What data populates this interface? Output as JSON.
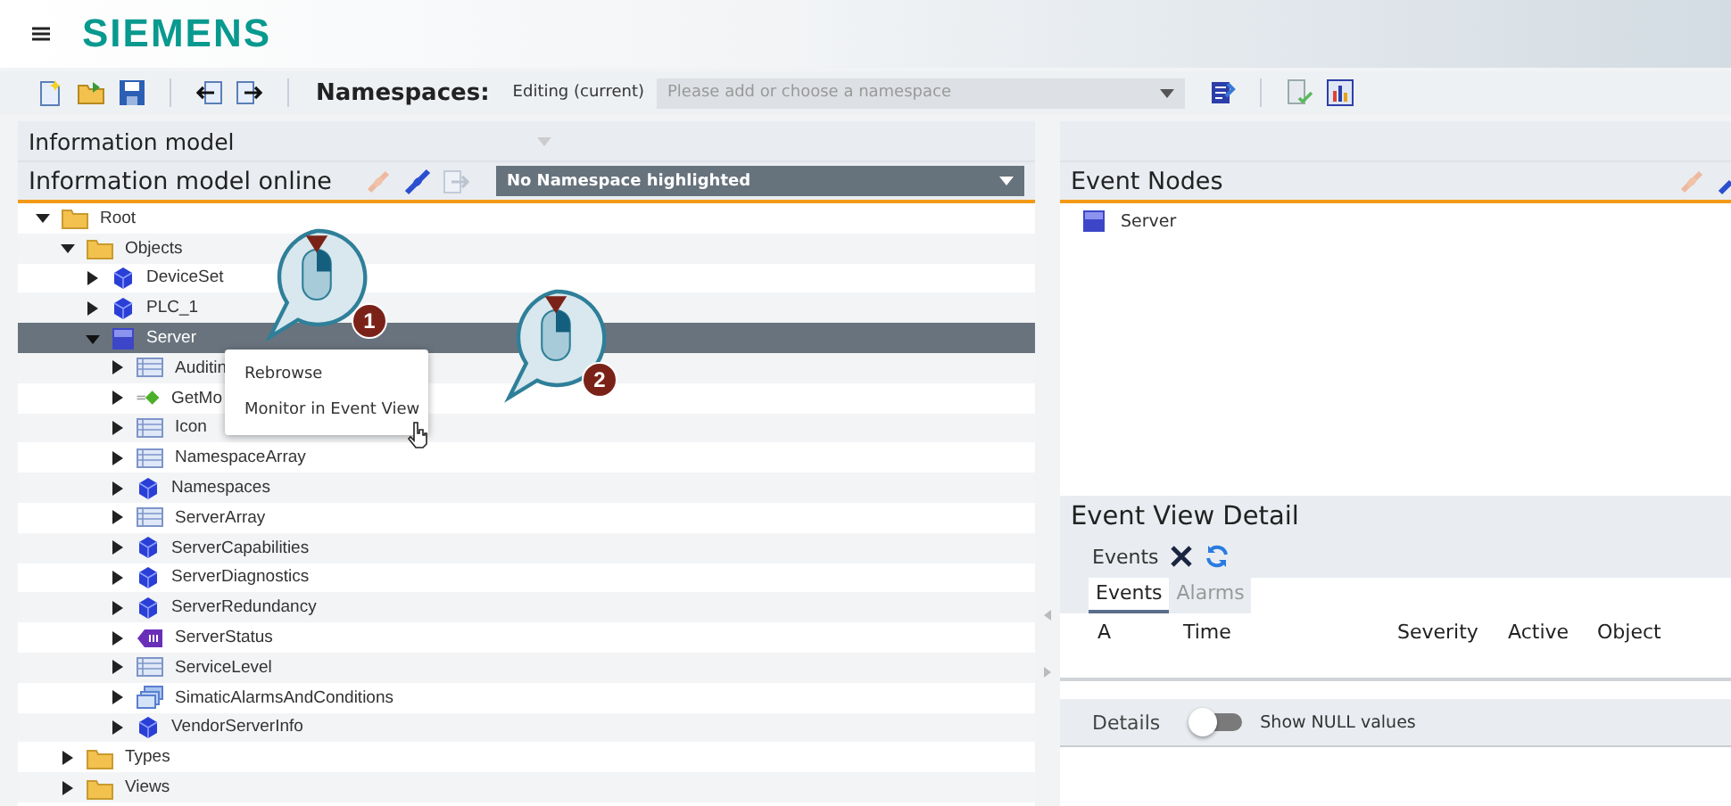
{
  "header": {
    "logo": "SIEMENS"
  },
  "toolbar": {
    "namespaces_label": "Namespaces:",
    "mode": "Editing (current)",
    "namespace_select": {
      "placeholder": "Please add or choose a namespace"
    }
  },
  "left_panel": {
    "title": "Information model",
    "subtitle": "Information model online",
    "highlight_select": {
      "value": "No Namespace highlighted"
    },
    "tree": [
      {
        "label": "Root",
        "kind": "folder",
        "expanded": true,
        "selected": false,
        "children": [
          {
            "label": "Objects",
            "kind": "folder",
            "expanded": true,
            "selected": false,
            "children": [
              {
                "label": "DeviceSet",
                "kind": "cube",
                "expanded": false,
                "selected": false
              },
              {
                "label": "PLC_1",
                "kind": "cube",
                "expanded": false,
                "selected": false
              },
              {
                "label": "Server",
                "kind": "opc",
                "expanded": true,
                "selected": true,
                "children": [
                  {
                    "label": "Auditin",
                    "kind": "table",
                    "expanded": false,
                    "selected": false
                  },
                  {
                    "label": "GetMo",
                    "kind": "method",
                    "expanded": false,
                    "selected": false
                  },
                  {
                    "label": "Icon",
                    "kind": "table",
                    "expanded": false,
                    "selected": false
                  },
                  {
                    "label": "NamespaceArray",
                    "kind": "table",
                    "expanded": false,
                    "selected": false
                  },
                  {
                    "label": "Namespaces",
                    "kind": "cube",
                    "expanded": false,
                    "selected": false
                  },
                  {
                    "label": "ServerArray",
                    "kind": "table",
                    "expanded": false,
                    "selected": false
                  },
                  {
                    "label": "ServerCapabilities",
                    "kind": "cube",
                    "expanded": false,
                    "selected": false
                  },
                  {
                    "label": "ServerDiagnostics",
                    "kind": "cube",
                    "expanded": false,
                    "selected": false
                  },
                  {
                    "label": "ServerRedundancy",
                    "kind": "cube",
                    "expanded": false,
                    "selected": false
                  },
                  {
                    "label": "ServerStatus",
                    "kind": "tag",
                    "expanded": false,
                    "selected": false
                  },
                  {
                    "label": "ServiceLevel",
                    "kind": "table",
                    "expanded": false,
                    "selected": false
                  },
                  {
                    "label": "SimaticAlarmsAndConditions",
                    "kind": "alarms",
                    "expanded": false,
                    "selected": false
                  },
                  {
                    "label": "VendorServerInfo",
                    "kind": "cube",
                    "expanded": false,
                    "selected": false
                  }
                ]
              }
            ]
          },
          {
            "label": "Types",
            "kind": "folder",
            "expanded": false,
            "selected": false
          },
          {
            "label": "Views",
            "kind": "folder",
            "expanded": false,
            "selected": false
          }
        ]
      }
    ]
  },
  "context_menu": {
    "items": [
      {
        "label": "Rebrowse"
      },
      {
        "label": "Monitor in Event View"
      }
    ]
  },
  "callouts": [
    {
      "number": "1"
    },
    {
      "number": "2"
    }
  ],
  "event_nodes": {
    "title": "Event Nodes",
    "items": [
      {
        "label": "Server"
      }
    ]
  },
  "event_view_detail": {
    "title": "Event View Detail",
    "toolbar_label": "Events",
    "tabs": [
      {
        "label": "Events",
        "selected": true
      },
      {
        "label": "Alarms",
        "selected": false
      }
    ],
    "columns": [
      "A",
      "Time",
      "Severity",
      "Active",
      "Object"
    ]
  },
  "details": {
    "label": "Details",
    "toggle": {
      "on": false,
      "label": "Show NULL values"
    }
  }
}
